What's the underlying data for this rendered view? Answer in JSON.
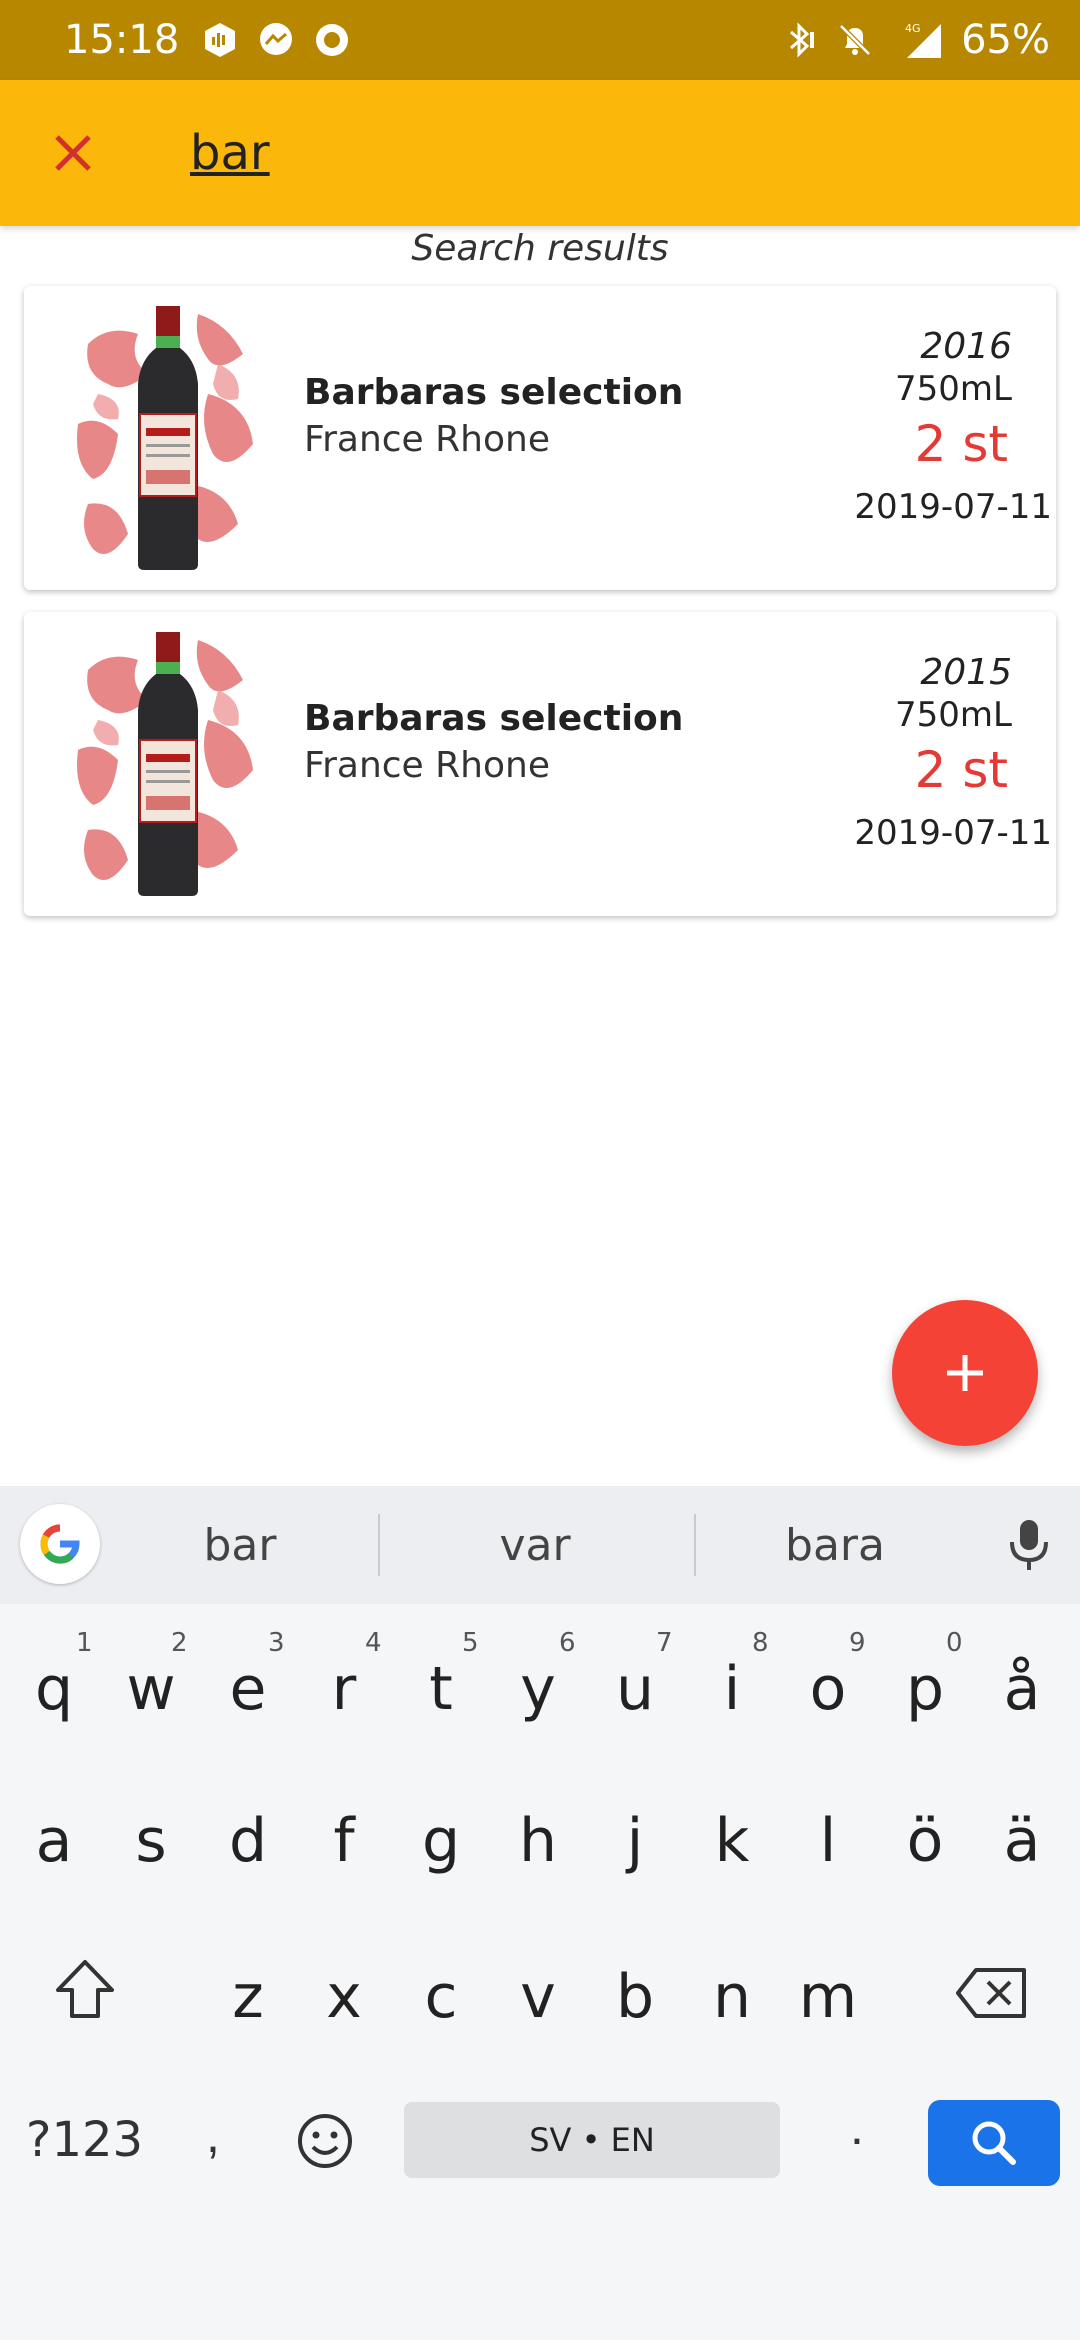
{
  "status_bar": {
    "time": "15:18",
    "battery": "65%",
    "left_icons": [
      "notification-icon",
      "messenger-icon",
      "circle-app-icon"
    ],
    "right_icons": [
      "bluetooth-icon",
      "mute-icon",
      "signal-4g-icon"
    ],
    "network_label": "4G"
  },
  "app_bar": {
    "close_icon": "close-icon",
    "search_value": "bar",
    "close_color": "#d32f2f",
    "background": "#fbb80a"
  },
  "results": {
    "title": "Search results",
    "items": [
      {
        "name": "Barbaras selection",
        "region": "France Rhone",
        "year": "2016",
        "volume": "750mL",
        "count": "2 st",
        "date": "2019-07-11"
      },
      {
        "name": "Barbaras selection",
        "region": "France Rhone",
        "year": "2015",
        "volume": "750mL",
        "count": "2 st",
        "date": "2019-07-11"
      }
    ]
  },
  "fab": {
    "icon": "plus-icon",
    "color": "#f44336"
  },
  "keyboard": {
    "suggestions": [
      "bar",
      "var",
      "bara"
    ],
    "row1": [
      "q",
      "w",
      "e",
      "r",
      "t",
      "y",
      "u",
      "i",
      "o",
      "p",
      "å"
    ],
    "row1_hints": [
      "1",
      "2",
      "3",
      "4",
      "5",
      "6",
      "7",
      "8",
      "9",
      "0"
    ],
    "row2": [
      "a",
      "s",
      "d",
      "f",
      "g",
      "h",
      "j",
      "k",
      "l",
      "ö",
      "ä"
    ],
    "row3": [
      "z",
      "x",
      "c",
      "v",
      "b",
      "n",
      "m"
    ],
    "sym_label": "?123",
    "comma": ",",
    "space_label": "SV • EN",
    "period": ".",
    "search_color": "#1a73e8"
  }
}
